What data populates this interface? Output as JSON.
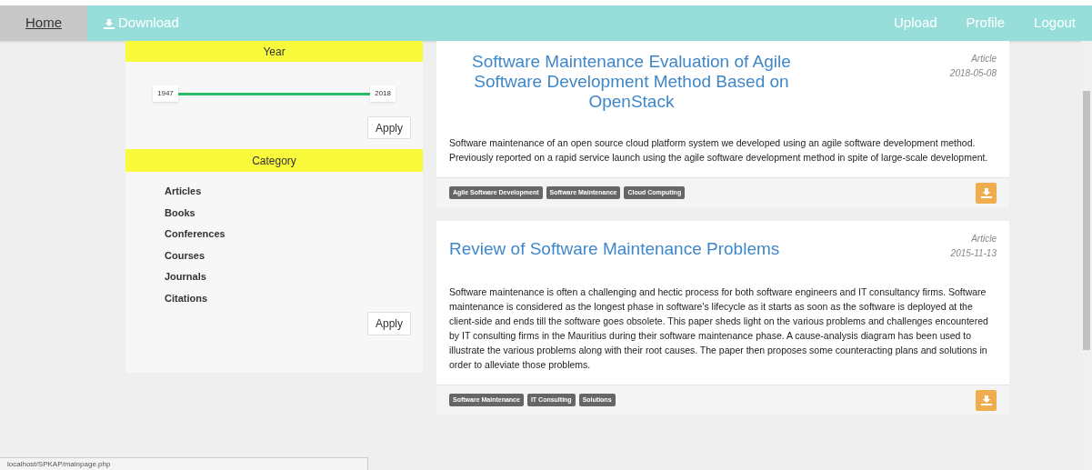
{
  "navbar": {
    "items": [
      {
        "label": "Home",
        "kind": "text",
        "selected": true
      },
      {
        "label": "Download",
        "kind": "download",
        "selected": false
      }
    ],
    "right_items": [
      {
        "label": "Upload"
      },
      {
        "label": "Profile"
      },
      {
        "label": "Logout"
      }
    ]
  },
  "filters": {
    "year": {
      "title": "Year",
      "from": "1947",
      "to": "2018",
      "level": 1,
      "apply": "Apply"
    },
    "category": {
      "title": "Category",
      "items": [
        "Articles",
        "Books",
        "Conferences",
        "Courses",
        "Journals",
        "Citations"
      ],
      "apply": "Apply"
    }
  },
  "results": [
    {
      "title": "Software Maintenance Evaluation of Agile Software Development Method Based on OpenStack",
      "centered": true,
      "type": "Article",
      "date": "2018-05-08",
      "abstract": "Software maintenance of an open source cloud platform system we developed using an agile software development method. Previously reported on a rapid service launch using the agile software development method in spite of large-scale development.",
      "tags": [
        "Agile Software Development",
        "Software Maintenance",
        "Cloud Computing"
      ]
    },
    {
      "title": "Review of Software Maintenance Problems",
      "centered": false,
      "type": "Article",
      "date": "2015-11-13",
      "abstract": "Software maintenance is often a challenging and hectic process for both software engineers and IT consultancy firms. Software maintenance is considered as the longest phase in software's lifecycle as it starts as soon as the software is deployed at the client-side and ends till the software goes obsolete. This paper sheds light on the various problems and challenges encountered by IT consulting firms in the Mauritius during their software maintenance phase. A cause-analysis diagram has been used to illustrate the various problems along with their root causes. The paper then proposes some counteracting plans and solutions in order to alleviate those problems.",
      "tags": [
        "Software Maintenance",
        "IT Consulting",
        "Solutions"
      ]
    }
  ],
  "status_bar": {
    "url": "localhost/SPKAP/mainpage.php"
  }
}
